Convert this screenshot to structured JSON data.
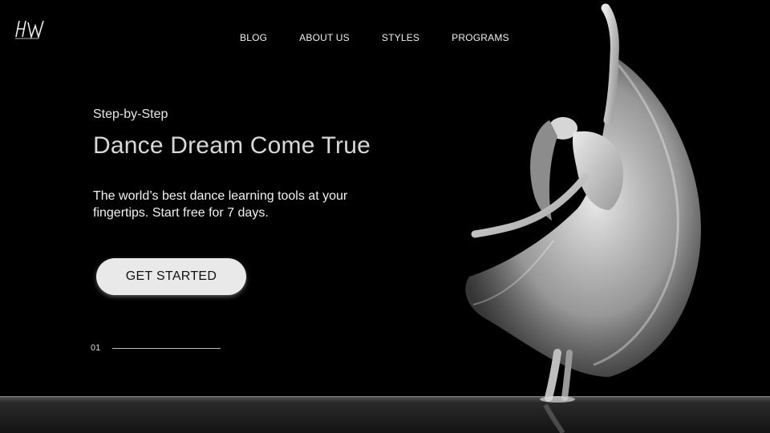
{
  "brand": {
    "logo_text": "HW"
  },
  "nav": {
    "items": [
      {
        "label": "BLOG"
      },
      {
        "label": "ABOUT US"
      },
      {
        "label": "STYLES"
      },
      {
        "label": "PROGRAMS"
      }
    ]
  },
  "hero": {
    "eyebrow": "Step-by-Step",
    "headline": "Dance Dream Come True",
    "tagline": "The world’s best dance learning tools  at your fingertips. Start free for 7 days.",
    "cta_label": "GET STARTED",
    "slide_number": "01"
  },
  "image": {
    "subject": "dancer-photo"
  },
  "colors": {
    "background": "#000000",
    "button": "#e9e9e9",
    "text": "#e6e6e6"
  }
}
